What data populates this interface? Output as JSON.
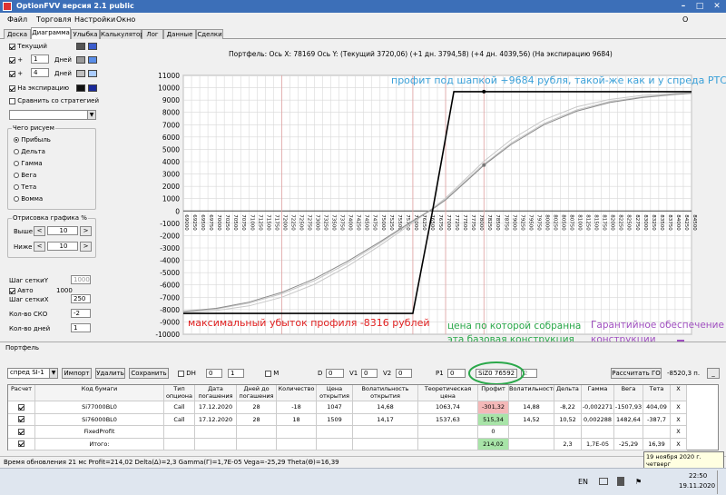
{
  "window": {
    "title": "OptionFVV версия 2.1 public",
    "btn_min": "–",
    "btn_max": "□",
    "btn_close": "✕"
  },
  "menu": {
    "items": [
      "Файл",
      "Торговля",
      "Настройки",
      "Окно"
    ],
    "about": "О программе"
  },
  "tabs": [
    "Доска",
    "Диаграмма",
    "Улыбка",
    "Калькулятор",
    "Лог",
    "Данные",
    "Сделки"
  ],
  "sidebar": {
    "current_label": "Текущий",
    "plus1_sign": "+",
    "plus1_value": "1",
    "plus1_unit": "Дней",
    "plus4_sign": "+",
    "plus4_value": "4",
    "plus4_unit": "Дней",
    "expiry_label": "На экспирацию",
    "compare_label": "Сравнить со стратегией",
    "draw_group": "Чего рисуем",
    "draw_options": [
      "Прибыль",
      "Дельта",
      "Гамма",
      "Вега",
      "Тета",
      "Вомма"
    ],
    "scale_group": "Отрисовка графика %",
    "above_label": "Выше",
    "above_value": "10",
    "below_label": "Ниже",
    "below_value": "10",
    "grid_y_label": "Шаг сеткиY",
    "grid_y_value": "1000",
    "auto_label": "Авто",
    "auto_value": "1000",
    "grid_x_label": "Шаг сеткиX",
    "grid_x_value": "250",
    "sko_label": "Кол-во СКО",
    "sko_value": "-2",
    "days_label": "Кол-во дней",
    "days_value": "1",
    "swatch_colors": [
      "#555555",
      "#3b5ccc",
      "#9a9a9a",
      "#5a8ee8",
      "#c0c0c0",
      "#aaccff",
      "#111111",
      "#1a2a9a"
    ]
  },
  "chart": {
    "header": "Портфель:  Ось X: 78169 Ось Y:   (Текущий 3720,06)   (+1 дн. 3794,58)   (+4 дн. 4039,56)   (На экспирацию 9684)",
    "annotation_top": "профит под шапкой +9684 рубля, такой-же как и у спреда РТС",
    "annotation_bottom": "максимальный убыток профиля -8316 рублей",
    "annotation_price": "цена по которой собранна\nэта базовая конструкция",
    "annotation_go": "Гарантийное обеспечение\nконструкции",
    "colors": {
      "expiry": "#000000",
      "current": "#8a8a8a",
      "plus": "#c8c8c8",
      "grid": "#d8d8d8",
      "vline": "#e0a0a0"
    }
  },
  "chart_data": {
    "type": "line",
    "title": "",
    "xlabel": "",
    "ylabel": "",
    "ylim": [
      -10000,
      11000
    ],
    "xlim": [
      69000,
      84500
    ],
    "y_ticks": [
      11000,
      10000,
      9000,
      8000,
      7000,
      6000,
      5000,
      4000,
      3000,
      2000,
      1000,
      0,
      -1000,
      -2000,
      -3000,
      -4000,
      -5000,
      -6000,
      -7000,
      -8000,
      -9000,
      -10000
    ],
    "x_ticks": [
      69000,
      69250,
      69500,
      69750,
      70000,
      70250,
      70500,
      70750,
      71000,
      71250,
      71500,
      71750,
      72000,
      72250,
      72500,
      72750,
      73000,
      73250,
      73500,
      73750,
      74000,
      74250,
      74500,
      74750,
      75000,
      75250,
      75500,
      75750,
      76000,
      76250,
      76500,
      76750,
      77000,
      77250,
      77500,
      77750,
      78000,
      78250,
      78500,
      78750,
      79000,
      79250,
      79500,
      79750,
      80000,
      80250,
      80500,
      80750,
      81000,
      81250,
      81500,
      81750,
      82000,
      82250,
      82500,
      82750,
      83000,
      83250,
      83500,
      83750,
      84000,
      84250,
      84500
    ],
    "series": [
      {
        "x": [
          69000,
          76000,
          76600,
          77250,
          78169,
          84500
        ],
        "y": [
          -8316,
          -8316,
          0,
          9684,
          9684,
          9684
        ]
      },
      {
        "x": [
          69000,
          70000,
          71000,
          72000,
          73000,
          74000,
          75000,
          76000,
          76600,
          77000,
          78000,
          78169,
          79000,
          80000,
          81000,
          82000,
          83000,
          84000,
          84500
        ],
        "y": [
          -8150,
          -7900,
          -7400,
          -6600,
          -5500,
          -4100,
          -2500,
          -800,
          150,
          900,
          3300,
          3720,
          5400,
          7000,
          8100,
          8800,
          9200,
          9450,
          9550
        ]
      },
      {
        "x": [
          69000,
          70000,
          71000,
          72000,
          73000,
          74000,
          75000,
          76000,
          76600,
          77000,
          78000,
          78169,
          79000,
          80000,
          81000,
          82000,
          83000,
          84000,
          84500
        ],
        "y": [
          -8180,
          -7950,
          -7480,
          -6720,
          -5650,
          -4250,
          -2600,
          -850,
          180,
          950,
          3400,
          3795,
          5500,
          7100,
          8200,
          8880,
          9260,
          9490,
          9580
        ]
      },
      {
        "x": [
          69000,
          70000,
          71000,
          72000,
          73000,
          74000,
          75000,
          76000,
          76600,
          77000,
          78000,
          78169,
          79000,
          80000,
          81000,
          82000,
          83000,
          84000,
          84500
        ],
        "y": [
          -8250,
          -8080,
          -7700,
          -7000,
          -5950,
          -4500,
          -2800,
          -950,
          220,
          1050,
          3600,
          4040,
          5800,
          7400,
          8450,
          9050,
          9380,
          9560,
          9620
        ]
      }
    ],
    "markers": [
      {
        "x": 78169,
        "y": 9684
      },
      {
        "x": 78169,
        "y": 3720
      }
    ]
  },
  "portfolio": {
    "group_label": "Портфель",
    "select_value": "спред SI-1",
    "btn_import": "Импорт",
    "btn_delete": "Удалить",
    "btn_save": "Сохранить",
    "dh_label": "DH",
    "dh_a": "0",
    "dh_b": "1",
    "m_label": "M",
    "d_label": "D",
    "d_value": "0",
    "v1_label": "V1",
    "v1_value": "0",
    "v2_label": "V2",
    "v2_value": "0",
    "p1_label": "P1",
    "p1_value": "0",
    "price_value": "SiZ0 76592",
    "p2_value": "2",
    "btn_calc_go": "Рассчитать ГО",
    "go_value": "-8520,3 п.",
    "columns": [
      "Расчет",
      "Код бумаги",
      "Тип опциона",
      "Дата погашения",
      "Дней до погашения",
      "Количество",
      "Цена открытия",
      "Волатильность открытия",
      "Теоретическая цена",
      "Профит",
      "Волатильность",
      "Дельта",
      "Гамма",
      "Вега",
      "Тета",
      "X"
    ],
    "rows": [
      {
        "code": "Si77000BL0",
        "type": "Call",
        "date": "17.12.2020",
        "days": "28",
        "qty": "-18",
        "open": "1047",
        "vol_open": "14,68",
        "theor": "1063,74",
        "profit": "-301,32",
        "vol": "14,88",
        "delta": "-8,22",
        "gamma": "-0,002271",
        "vega": "-1507,93",
        "theta": "404,09",
        "x": "X"
      },
      {
        "code": "Si76000BL0",
        "type": "Call",
        "date": "17.12.2020",
        "days": "28",
        "qty": "18",
        "open": "1509",
        "vol_open": "14,17",
        "theor": "1537,63",
        "profit": "515,34",
        "vol": "14,52",
        "delta": "10,52",
        "gamma": "0,002288",
        "vega": "1482,64",
        "theta": "-387,7",
        "x": "X"
      },
      {
        "code": "FixedProfit",
        "type": "",
        "date": "",
        "days": "",
        "qty": "",
        "open": "",
        "vol_open": "",
        "theor": "",
        "profit": "0",
        "vol": "",
        "delta": "",
        "gamma": "",
        "vega": "",
        "theta": "",
        "x": "X"
      },
      {
        "code": "Итого:",
        "type": "",
        "date": "",
        "days": "",
        "qty": "",
        "open": "",
        "vol_open": "",
        "theor": "",
        "profit": "214,02",
        "vol": "",
        "delta": "2,3",
        "gamma": "1,7E-05",
        "vega": "-25,29",
        "theta": "16,39",
        "x": "X"
      }
    ]
  },
  "status": {
    "text": "Время обновления 21 мс  Profit=214,02 Delta(Δ)=2,3 Gamma(Γ)=1,7E-05 Vega=-25,29 Theta(Θ)=16,39"
  },
  "tooltip": {
    "date": "19 ноября 2020 г.",
    "day": "четверг"
  },
  "taskbar": {
    "lang": "EN",
    "time": "22:50",
    "date": "19.11.2020"
  }
}
